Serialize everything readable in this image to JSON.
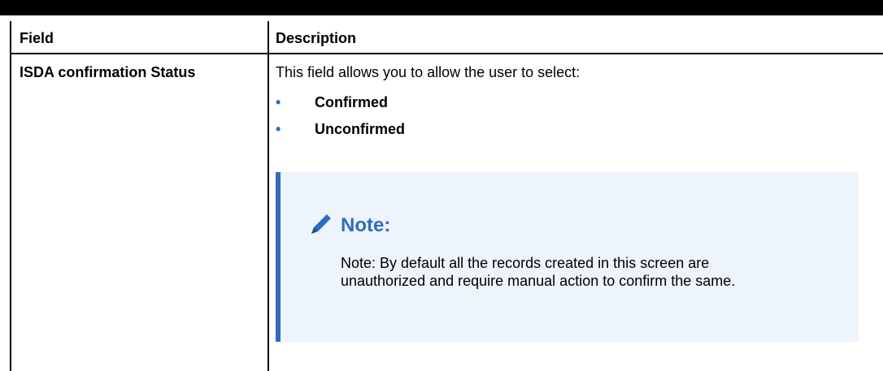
{
  "table": {
    "headers": [
      "Field",
      "Description"
    ],
    "rows": [
      {
        "field": "ISDA confirmation Status",
        "description": {
          "intro": "This field allows you to allow the user to select:",
          "options": [
            "Confirmed",
            "Unconfirmed"
          ],
          "note": {
            "title": "Note:",
            "icon": "pencil-icon",
            "text": "Note: By default all the records created in this screen are unauthorized and require manual action to confirm the same."
          }
        }
      }
    ]
  },
  "colors": {
    "accent": "#2f6cc0",
    "note_background": "#eef4fb",
    "bullet": "#2b6cc4"
  }
}
